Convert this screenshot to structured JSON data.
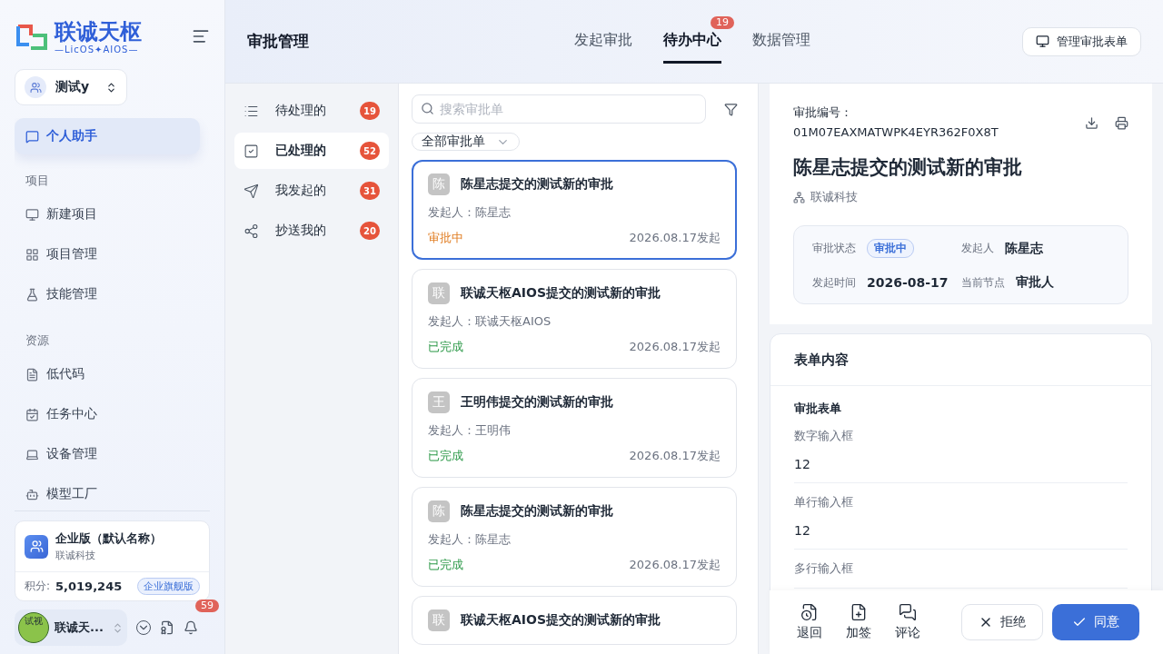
{
  "sidebar": {
    "logo_title": "联诚天枢",
    "logo_subtitle": "—LicOS✦AIOS—",
    "workspace": "测试y",
    "assistant": {
      "label": "个人助手",
      "selected": true
    },
    "sections": [
      {
        "title": "项目",
        "items": [
          {
            "label": "新建项目"
          },
          {
            "label": "项目管理"
          },
          {
            "label": "技能管理"
          }
        ]
      },
      {
        "title": "资源",
        "items": [
          {
            "label": "低代码"
          },
          {
            "label": "任务中心"
          },
          {
            "label": "设备管理"
          },
          {
            "label": "模型工厂"
          }
        ]
      }
    ],
    "org": {
      "name": "企业版（默认名称）",
      "company": "联诚科技",
      "points_label": "积分:",
      "points": "5,019,245",
      "plan": "企业旗舰版"
    },
    "user": {
      "avatar_text": "试视",
      "name": "联诚天...",
      "notifications": "59"
    }
  },
  "header": {
    "title": "审批管理",
    "tabs": [
      {
        "label": "发起审批",
        "selected": false
      },
      {
        "label": "待办中心",
        "selected": true,
        "badge": "19"
      },
      {
        "label": "数据管理",
        "selected": false
      }
    ],
    "manage_button": "管理审批表单"
  },
  "categories": [
    {
      "label": "待处理的",
      "count": "19",
      "selected": false
    },
    {
      "label": "已处理的",
      "count": "52",
      "selected": true
    },
    {
      "label": "我发起的",
      "count": "31",
      "selected": false
    },
    {
      "label": "抄送我的",
      "count": "20",
      "selected": false
    }
  ],
  "search": {
    "placeholder": "搜索审批单"
  },
  "filter": "全部审批单",
  "approvals": [
    {
      "avatar": "陈",
      "title": "陈星志提交的测试新的审批",
      "initiator": "发起人：陈星志",
      "status": "审批中",
      "completed": false,
      "date": "2026.08.17发起",
      "selected": true
    },
    {
      "avatar": "联",
      "title": "联诚天枢AIOS提交的测试新的审批",
      "initiator": "发起人：联诚天枢AIOS",
      "status": "已完成",
      "completed": true,
      "date": "2026.08.17发起",
      "selected": false
    },
    {
      "avatar": "王",
      "title": "王明伟提交的测试新的审批",
      "initiator": "发起人：王明伟",
      "status": "已完成",
      "completed": true,
      "date": "2026.08.17发起",
      "selected": false
    },
    {
      "avatar": "陈",
      "title": "陈星志提交的测试新的审批",
      "initiator": "发起人：陈星志",
      "status": "已完成",
      "completed": true,
      "date": "2026.08.17发起",
      "selected": false
    },
    {
      "avatar": "联",
      "title": "联诚天枢AIOS提交的测试新的审批",
      "selected": false
    }
  ],
  "detail": {
    "number_label": "审批编号：",
    "number": "01M07EAXMATWPK4EYR362F0X8T",
    "title": "陈星志提交的测试新的审批",
    "company": "联诚科技",
    "info": [
      {
        "label": "审批状态",
        "value": "审批中",
        "kind": "badge"
      },
      {
        "label": "发起人",
        "value": "陈星志",
        "kind": "text"
      },
      {
        "label": "发起时间",
        "value": "2026-08-17",
        "kind": "text"
      },
      {
        "label": "当前节点",
        "value": "审批人",
        "kind": "text"
      }
    ],
    "form_title": "表单内容",
    "form_name": "审批表单",
    "fields": [
      {
        "label": "数字输入框",
        "value": "12"
      },
      {
        "label": "单行输入框",
        "value": "12"
      },
      {
        "label": "多行输入框"
      }
    ],
    "actions": [
      {
        "label": "退回"
      },
      {
        "label": "加签"
      },
      {
        "label": "评论"
      }
    ],
    "reject": "拒绝",
    "approve": "同意"
  }
}
